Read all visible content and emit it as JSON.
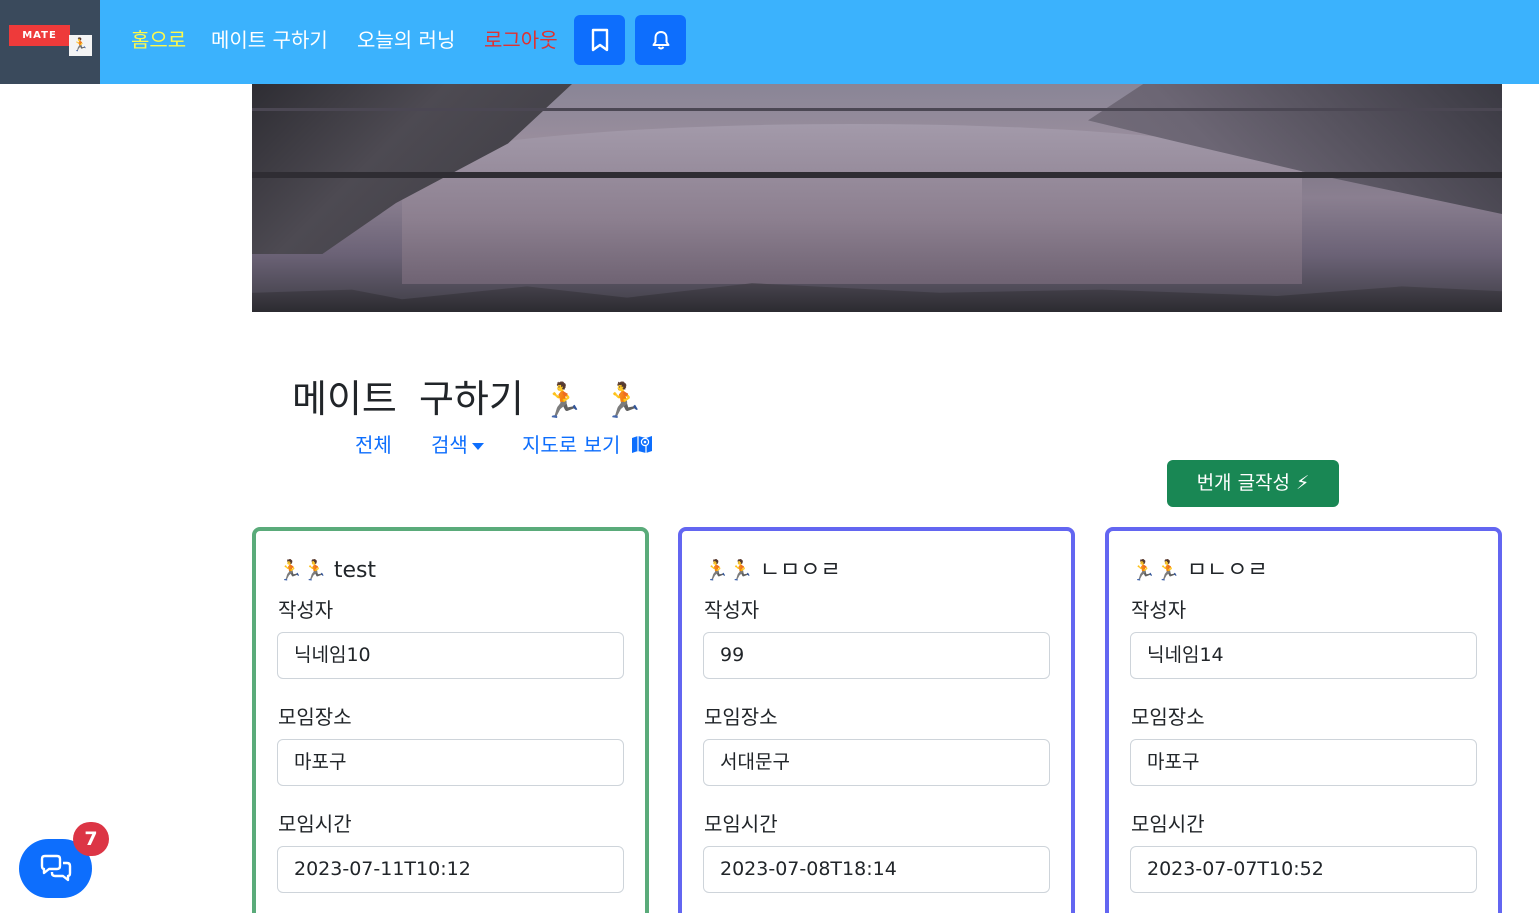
{
  "navbar": {
    "logo_text": "MATE",
    "logo_glyph": "🏃",
    "links": {
      "home": "홈으로",
      "find_mate": "메이트 구하기",
      "today_running": "오늘의 러닝",
      "logout": "로그아웃"
    },
    "icons": {
      "bookmark": "bookmark-icon",
      "bell": "bell-icon"
    },
    "colors": {
      "background": "#3bb2fd",
      "home": "#fff94b",
      "logout": "#e03131",
      "button": "#0d6efd"
    }
  },
  "main": {
    "title": "메이트 구하기",
    "title_emoji_1": "🏃",
    "title_emoji_2": "🏃",
    "subnav": {
      "all": "전체",
      "search": "검색",
      "map_view": "지도로 보기"
    },
    "write_button": "번개 글작성 ⚡"
  },
  "cards": [
    {
      "emoji": "🏃🏃",
      "title": "test",
      "author_label": "작성자",
      "author": "닉네임10",
      "place_label": "모임장소",
      "place": "마포구",
      "time_label": "모임시간",
      "time": "2023-07-11T10:12",
      "border_color": "#5aab7a"
    },
    {
      "emoji": "🏃🏃",
      "title": "ㄴㅁㅇㄹ",
      "author_label": "작성자",
      "author": "99",
      "place_label": "모임장소",
      "place": "서대문구",
      "time_label": "모임시간",
      "time": "2023-07-08T18:14",
      "border_color": "#6366f1"
    },
    {
      "emoji": "🏃🏃",
      "title": "ㅁㄴㅇㄹ",
      "author_label": "작성자",
      "author": "닉네임14",
      "place_label": "모임장소",
      "place": "마포구",
      "time_label": "모임시간",
      "time": "2023-07-07T10:52",
      "border_color": "#6366f1"
    }
  ],
  "chat": {
    "icon": "chat-bubbles-icon",
    "badge_count": "7"
  }
}
